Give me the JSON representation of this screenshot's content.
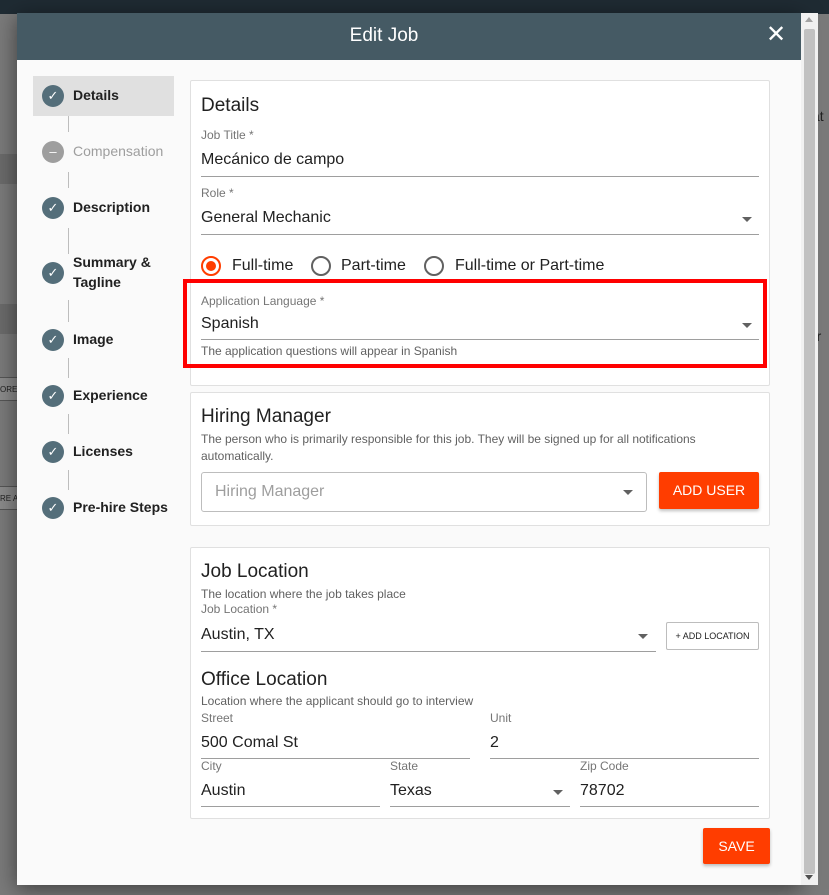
{
  "modal": {
    "title": "Edit Job"
  },
  "stepper": {
    "steps": [
      {
        "label": "Details",
        "state": "complete"
      },
      {
        "label": "Compensation",
        "state": "pending"
      },
      {
        "label": "Description",
        "state": "complete"
      },
      {
        "label": "Summary & Tagline",
        "state": "complete"
      },
      {
        "label": "Image",
        "state": "complete"
      },
      {
        "label": "Experience",
        "state": "complete"
      },
      {
        "label": "Licenses",
        "state": "complete"
      },
      {
        "label": "Pre-hire Steps",
        "state": "complete"
      }
    ],
    "check_glyph": "✓",
    "pending_glyph": "–"
  },
  "details": {
    "title": "Details",
    "job_title_label": "Job Title *",
    "job_title_value": "Mecánico de campo",
    "role_label": "Role  *",
    "role_value": "General Mechanic",
    "employment_options": [
      "Full-time",
      "Part-time",
      "Full-time or Part-time"
    ],
    "employment_selected": "Full-time",
    "language_label": "Application Language *",
    "language_value": "Spanish",
    "language_helper": "The application questions will appear in Spanish"
  },
  "hiring_manager": {
    "title": "Hiring Manager",
    "description": "The person who is primarily responsible for this job. They will be signed up for all notifications automatically.",
    "placeholder": "Hiring Manager",
    "add_user_label": "ADD USER"
  },
  "job_location": {
    "title": "Job Location",
    "description": "The location where the job takes place",
    "location_label": "Job Location  *",
    "location_value": "Austin, TX",
    "add_location_label": "+ ADD LOCATION",
    "office_title": "Office Location",
    "office_description": "Location where the applicant should go to interview",
    "street_label": "Street",
    "street_value": "500 Comal St",
    "unit_label": "Unit",
    "unit_value": "2",
    "city_label": "City",
    "city_value": "Austin",
    "state_label": "State",
    "state_value": "Texas",
    "zip_label": "Zip Code",
    "zip_value": "78702"
  },
  "actions": {
    "save_label": "SAVE"
  },
  "background": {
    "right_fragment_1": "at",
    "right_fragment_2": "rr",
    "left_fragment_1": "ORE",
    "left_fragment_2": "RE A"
  },
  "colors": {
    "accent": "#ff3d00",
    "header": "#455a64",
    "highlight": "#ff0000",
    "step": "#546e7a"
  }
}
